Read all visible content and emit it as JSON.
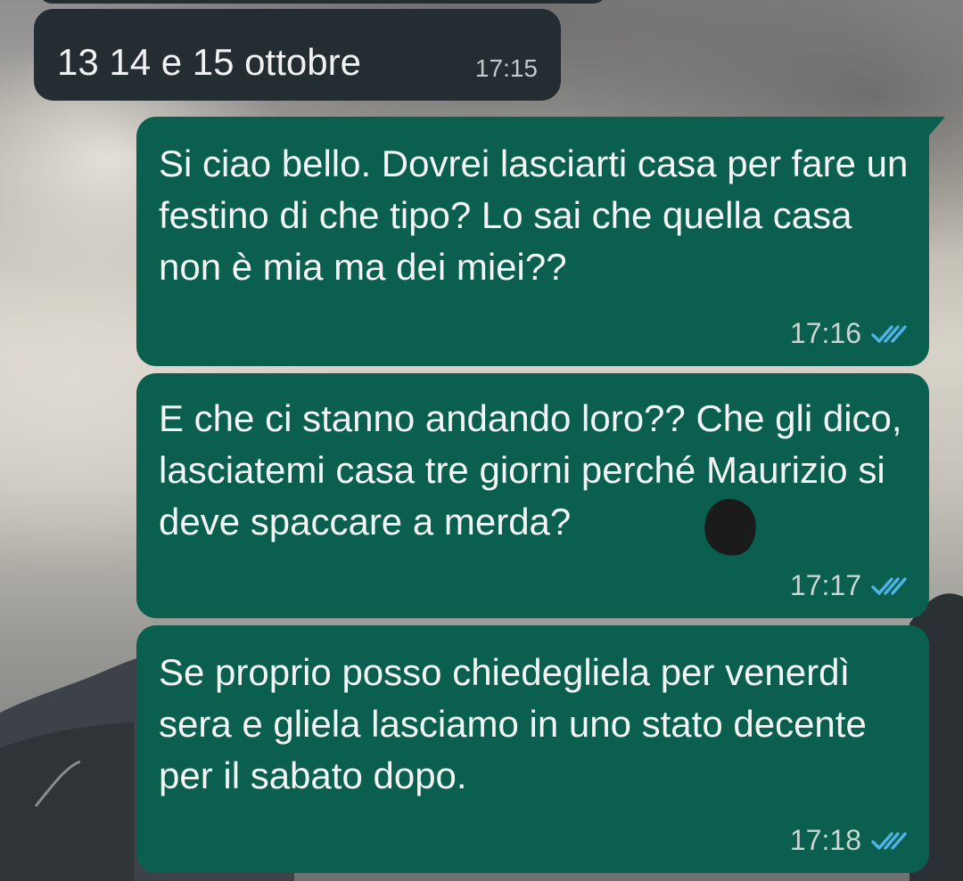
{
  "chat": {
    "messages": [
      {
        "direction": "incoming",
        "text": "13 14 e 15 ottobre",
        "time": "17:15"
      },
      {
        "direction": "outgoing",
        "text": "Si ciao bello. Dovrei lasciarti casa per fare un festino di che tipo? Lo sai che quella casa non è mia ma dei miei??",
        "time": "17:16",
        "status_icon": "double-check-read-icon"
      },
      {
        "direction": "outgoing",
        "text": "E che ci stanno andando loro?? Che gli dico, lasciatemi casa tre giorni perché Maurizio si deve spaccare a merda?",
        "time": "17:17",
        "status_icon": "double-check-read-icon"
      },
      {
        "direction": "outgoing",
        "text": "Se proprio posso chiedegliela per venerdì sera e gliela lasciamo in uno stato decente per il sabato dopo.",
        "time": "17:18",
        "status_icon": "double-check-read-icon"
      }
    ]
  },
  "colors": {
    "incoming_bubble": "#232d32",
    "outgoing_bubble": "#0b5f4f",
    "read_tick": "#4fb3e8"
  }
}
